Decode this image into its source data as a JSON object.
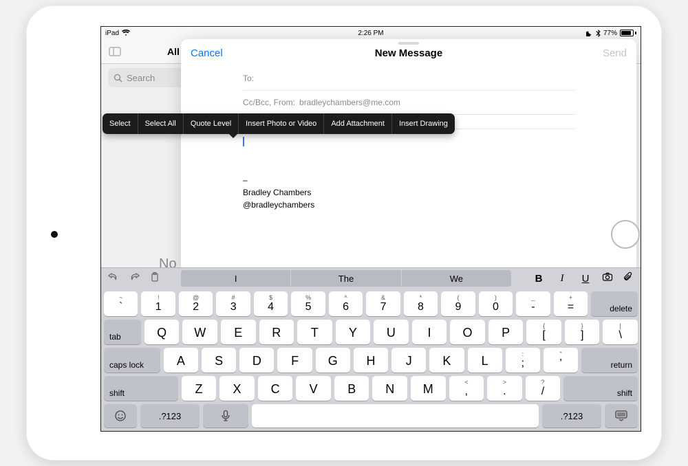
{
  "status": {
    "carrier": "iPad",
    "time": "2:26 PM",
    "battery": "77%"
  },
  "mail": {
    "all_inboxes": "All Inboxes",
    "search_placeholder": "Search",
    "no_mail": "No Mail"
  },
  "compose": {
    "cancel": "Cancel",
    "send": "Send",
    "title": "New Message",
    "to_label": "To:",
    "ccbcc_label": "Cc/Bcc, From:",
    "from_email": "bradleychambers@me.com",
    "signature_dash": "–",
    "signature_name": "Bradley Chambers",
    "signature_handle": "@bradleychambers"
  },
  "edit_menu": [
    "Select",
    "Select All",
    "Quote Level",
    "Insert Photo or Video",
    "Add Attachment",
    "Insert Drawing"
  ],
  "keyboard": {
    "suggestions": [
      "I",
      "The",
      "We"
    ],
    "row1": [
      {
        "sub": "~",
        "main": "`"
      },
      {
        "sub": "!",
        "main": "1"
      },
      {
        "sub": "@",
        "main": "2"
      },
      {
        "sub": "#",
        "main": "3"
      },
      {
        "sub": "$",
        "main": "4"
      },
      {
        "sub": "%",
        "main": "5"
      },
      {
        "sub": "^",
        "main": "6"
      },
      {
        "sub": "&",
        "main": "7"
      },
      {
        "sub": "*",
        "main": "8"
      },
      {
        "sub": "(",
        "main": "9"
      },
      {
        "sub": ")",
        "main": "0"
      },
      {
        "sub": "_",
        "main": "-"
      },
      {
        "sub": "+",
        "main": "="
      }
    ],
    "delete": "delete",
    "tab": "tab",
    "row2": [
      "Q",
      "W",
      "E",
      "R",
      "T",
      "Y",
      "U",
      "I",
      "O",
      "P"
    ],
    "row2_tail": [
      {
        "sub": "{",
        "main": "["
      },
      {
        "sub": "}",
        "main": "]"
      },
      {
        "sub": "|",
        "main": "\\"
      }
    ],
    "caps": "caps lock",
    "row3": [
      "A",
      "S",
      "D",
      "F",
      "G",
      "H",
      "J",
      "K",
      "L"
    ],
    "row3_tail": [
      {
        "sub": ":",
        "main": ";"
      },
      {
        "sub": "\"",
        "main": "'"
      }
    ],
    "return": "return",
    "shift": "shift",
    "row4": [
      "Z",
      "X",
      "C",
      "V",
      "B",
      "N",
      "M"
    ],
    "row4_tail": [
      {
        "sub": "<",
        "main": ","
      },
      {
        "sub": ">",
        "main": "."
      },
      {
        "sub": "?",
        "main": "/"
      }
    ],
    "numkey": ".?123"
  }
}
